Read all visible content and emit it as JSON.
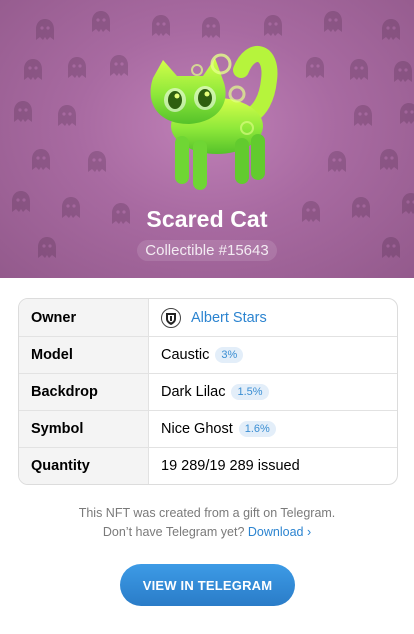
{
  "hero": {
    "title": "Scared Cat",
    "subtitle": "Collectible #15643",
    "backdrop_color": "#a86aa1",
    "pattern_icon": "ghost-icon",
    "art_icon": "scared-cat-icon"
  },
  "attributes": [
    {
      "key": "Owner",
      "value": "Albert Stars",
      "avatar_icon": "owner-avatar-icon"
    },
    {
      "key": "Model",
      "value": "Caustic",
      "badge": "3%"
    },
    {
      "key": "Backdrop",
      "value": "Dark Lilac",
      "badge": "1.5%"
    },
    {
      "key": "Symbol",
      "value": "Nice Ghost",
      "badge": "1.6%"
    },
    {
      "key": "Quantity",
      "value": "19 289/19 289 issued"
    }
  ],
  "footer": {
    "line1": "This NFT was created from a gift on Telegram.",
    "line2": "Don’t have Telegram yet?",
    "download_label": "Download ›"
  },
  "cta": {
    "label": "VIEW IN TELEGRAM",
    "color": "#2a7cc8"
  },
  "colors": {
    "link": "#2c84d0",
    "badge_bg": "#e3eef9",
    "badge_text": "#3a8ed3"
  }
}
